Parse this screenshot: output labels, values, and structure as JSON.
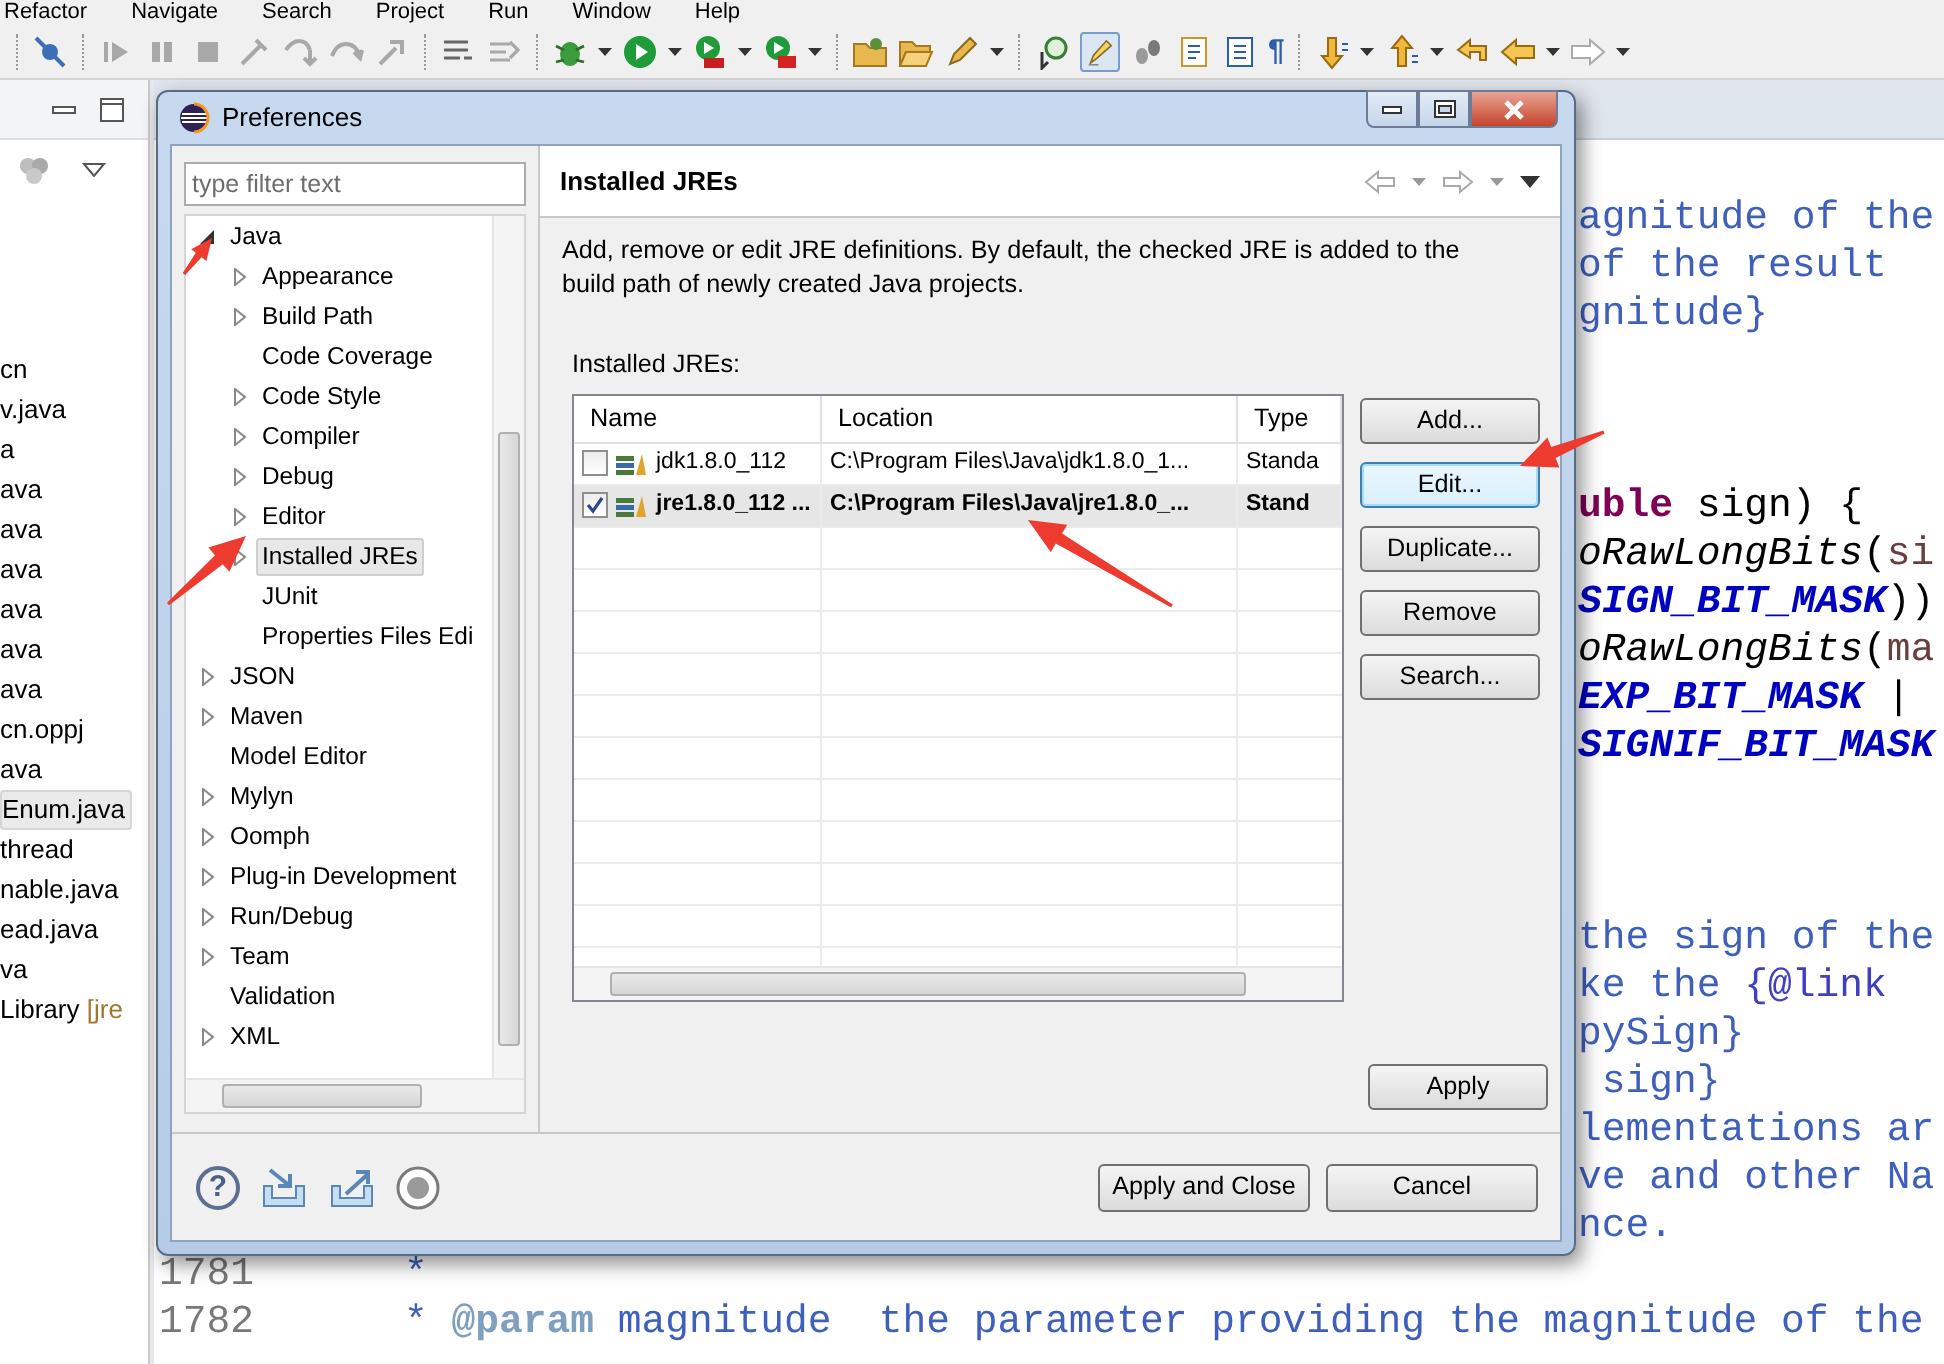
{
  "menu_bar": [
    "Refactor",
    "Navigate",
    "Search",
    "Project",
    "Run",
    "Window",
    "Help"
  ],
  "toolbar": {
    "pilcrow": "¶",
    "toggle_selected": true
  },
  "explorer": {
    "items": [
      {
        "label": "cn",
        "selected": false
      },
      {
        "label": "v.java",
        "selected": false
      },
      {
        "label": "a",
        "selected": false
      },
      {
        "label": "ava",
        "selected": false
      },
      {
        "label": "ava",
        "selected": false
      },
      {
        "label": "ava",
        "selected": false
      },
      {
        "label": "ava",
        "selected": false
      },
      {
        "label": "ava",
        "selected": false
      },
      {
        "label": "ava",
        "selected": false
      },
      {
        "label": "cn.oppj",
        "selected": false
      },
      {
        "label": "ava",
        "selected": false
      },
      {
        "label": "Enum.java",
        "selected": true
      },
      {
        "label": "thread",
        "selected": false
      },
      {
        "label": "nable.java",
        "selected": false
      },
      {
        "label": "ead.java",
        "selected": false
      },
      {
        "label": "va",
        "selected": false
      },
      {
        "label": "Library",
        "suffix": "[jre",
        "selected": false
      }
    ]
  },
  "editor": {
    "blocks": [
      [
        {
          "segments": [
            {
              "text": "agnitude of the",
              "kind": "comment"
            }
          ]
        },
        {
          "segments": [
            {
              "text": "of the result",
              "kind": "comment"
            }
          ]
        },
        {
          "segments": [
            {
              "text": "gnitude}",
              "kind": "comment"
            }
          ]
        }
      ],
      [
        {
          "segments": [
            {
              "text": "uble",
              "kind": "keyword"
            },
            {
              "text": " sign) {",
              "kind": "plain"
            }
          ]
        },
        {
          "segments": [
            {
              "text": "oRawLongBits",
              "kind": "static"
            },
            {
              "text": "(",
              "kind": "plain"
            },
            {
              "text": "si",
              "kind": "param"
            }
          ]
        },
        {
          "segments": [
            {
              "text": "SIGN_BIT_MASK",
              "kind": "constant"
            },
            {
              "text": "))",
              "kind": "plain"
            }
          ]
        },
        {
          "segments": [
            {
              "text": "oRawLongBits",
              "kind": "static"
            },
            {
              "text": "(",
              "kind": "plain"
            },
            {
              "text": "ma",
              "kind": "param"
            }
          ]
        },
        {
          "segments": [
            {
              "text": "EXP_BIT_MASK",
              "kind": "constant"
            },
            {
              "text": " |",
              "kind": "plain"
            }
          ]
        },
        {
          "segments": [
            {
              "text": "SIGNIF_BIT_MASK",
              "kind": "constant"
            }
          ]
        }
      ],
      [
        {
          "segments": [
            {
              "text": "the sign of the",
              "kind": "comment"
            }
          ]
        },
        {
          "segments": [
            {
              "text": "ke the ",
              "kind": "comment"
            },
            {
              "text": "{@link",
              "kind": "link"
            }
          ]
        },
        {
          "segments": [
            {
              "text": "pySign}",
              "kind": "comment"
            }
          ]
        },
        {
          "segments": [
            {
              "text": " sign}",
              "kind": "comment"
            }
          ]
        },
        {
          "segments": [
            {
              "text": "lementations ar",
              "kind": "comment"
            }
          ]
        },
        {
          "segments": [
            {
              "text": "ve and other Na",
              "kind": "comment"
            }
          ]
        },
        {
          "segments": [
            {
              "text": "nce.",
              "kind": "comment"
            }
          ]
        },
        {
          "number": "1781",
          "segments": [
            {
              "text": "*",
              "kind": "comment"
            }
          ]
        },
        {
          "number": "1782",
          "segments": [
            {
              "text": "* ",
              "kind": "comment"
            },
            {
              "text": "@param",
              "kind": "tag"
            },
            {
              "text": " magnitude  the parameter providing the magnitude of the",
              "kind": "comment"
            }
          ]
        }
      ]
    ]
  },
  "dialog": {
    "title": "Preferences",
    "filter": {
      "placeholder": "type filter text"
    },
    "tree": [
      {
        "label": "Java",
        "expandable": true,
        "expanded": true,
        "selected": false,
        "children": [
          {
            "label": "Appearance",
            "expandable": true,
            "expanded": false,
            "selected": false
          },
          {
            "label": "Build Path",
            "expandable": true,
            "expanded": false,
            "selected": false
          },
          {
            "label": "Code Coverage",
            "expandable": false,
            "selected": false
          },
          {
            "label": "Code Style",
            "expandable": true,
            "expanded": false,
            "selected": false
          },
          {
            "label": "Compiler",
            "expandable": true,
            "expanded": false,
            "selected": false
          },
          {
            "label": "Debug",
            "expandable": true,
            "expanded": false,
            "selected": false
          },
          {
            "label": "Editor",
            "expandable": true,
            "expanded": false,
            "selected": false
          },
          {
            "label": "Installed JREs",
            "expandable": true,
            "expanded": false,
            "selected": true
          },
          {
            "label": "JUnit",
            "expandable": false,
            "selected": false
          },
          {
            "label": "Properties Files Edi",
            "expandable": false,
            "selected": false
          }
        ]
      },
      {
        "label": "JSON",
        "expandable": true,
        "expanded": false,
        "selected": false
      },
      {
        "label": "Maven",
        "expandable": true,
        "expanded": false,
        "selected": false
      },
      {
        "label": "Model Editor",
        "expandable": false,
        "selected": false
      },
      {
        "label": "Mylyn",
        "expandable": true,
        "expanded": false,
        "selected": false
      },
      {
        "label": "Oomph",
        "expandable": true,
        "expanded": false,
        "selected": false
      },
      {
        "label": "Plug-in Development",
        "expandable": true,
        "expanded": false,
        "selected": false
      },
      {
        "label": "Run/Debug",
        "expandable": true,
        "expanded": false,
        "selected": false
      },
      {
        "label": "Team",
        "expandable": true,
        "expanded": false,
        "selected": false
      },
      {
        "label": "Validation",
        "expandable": false,
        "selected": false
      },
      {
        "label": "XML",
        "expandable": true,
        "expanded": false,
        "selected": false
      }
    ],
    "page": {
      "title": "Installed JREs",
      "description": "Add, remove or edit JRE definitions. By default, the checked JRE is added to the build path of newly created Java projects.",
      "table_label": "Installed JREs:",
      "table": {
        "columns": [
          "Name",
          "Location",
          "Type"
        ],
        "rows": [
          {
            "checked": false,
            "selected": false,
            "cells": [
              "jdk1.8.0_112",
              "C:\\Program Files\\Java\\jdk1.8.0_1...",
              "Standa"
            ]
          },
          {
            "checked": true,
            "selected": true,
            "cells": [
              "jre1.8.0_112 ...",
              "C:\\Program Files\\Java\\jre1.8.0_...",
              "Stand"
            ]
          }
        ]
      },
      "side_buttons": [
        {
          "label": "Add...",
          "focused": false
        },
        {
          "label": "Edit...",
          "focused": true
        },
        {
          "label": "Duplicate...",
          "focused": false
        },
        {
          "label": "Remove",
          "focused": false
        },
        {
          "label": "Search...",
          "focused": false
        }
      ],
      "apply": "Apply"
    },
    "help_mark": "?",
    "buttons": [
      "Apply and Close",
      "Cancel"
    ]
  }
}
